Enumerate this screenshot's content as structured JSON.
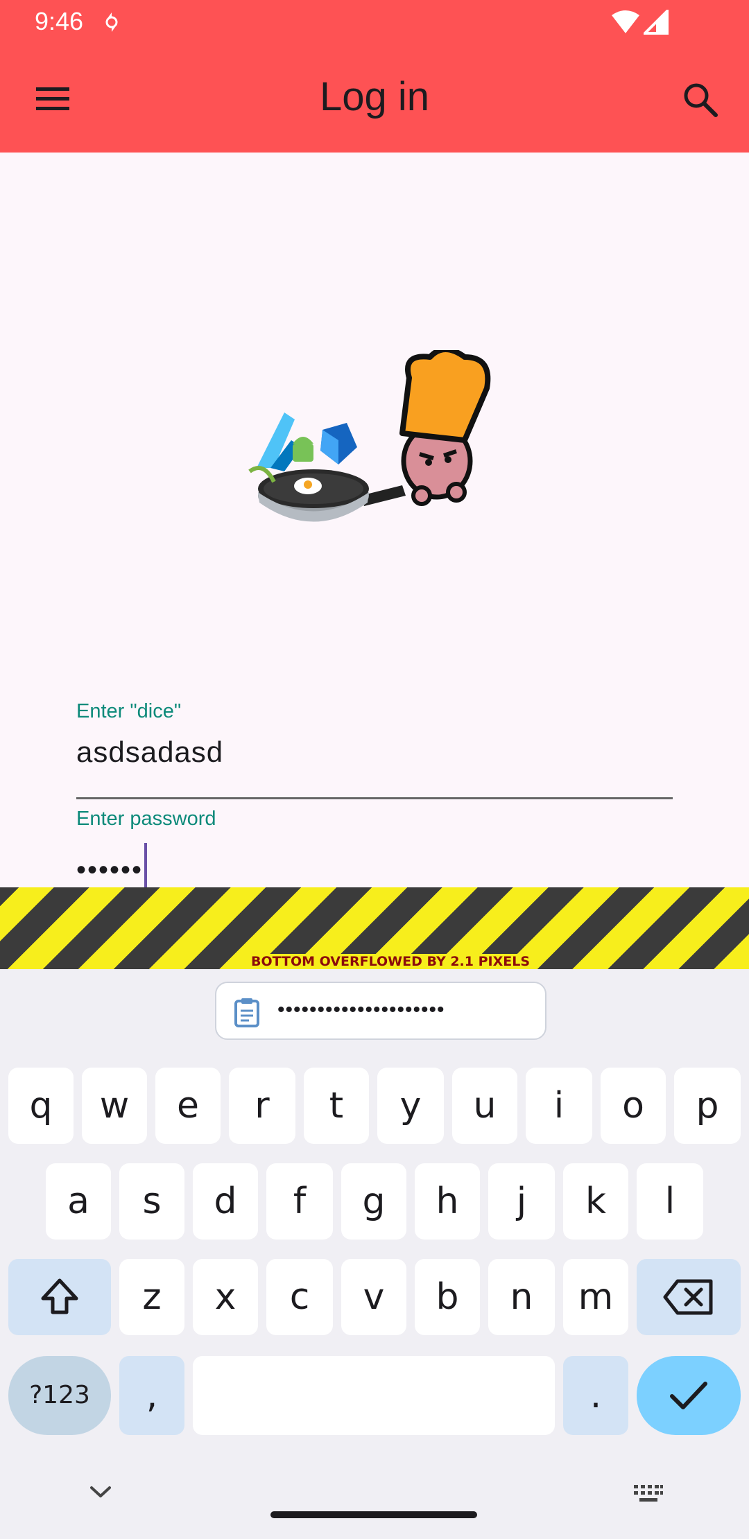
{
  "status_bar": {
    "time": "9:46"
  },
  "app_bar": {
    "title": "Log in"
  },
  "form": {
    "username_label": "Enter \"dice\"",
    "username_value": "asdsadasd",
    "password_label": "Enter password",
    "password_value": "••••••"
  },
  "overflow_message": "BOTTOM OVERFLOWED BY 2.1 PIXELS",
  "keyboard": {
    "clipboard_preview": "•••••••••••••••••••••",
    "row1": [
      "q",
      "w",
      "e",
      "r",
      "t",
      "y",
      "u",
      "i",
      "o",
      "p"
    ],
    "row2": [
      "a",
      "s",
      "d",
      "f",
      "g",
      "h",
      "j",
      "k",
      "l"
    ],
    "row3": [
      "z",
      "x",
      "c",
      "v",
      "b",
      "n",
      "m"
    ],
    "symbols_label": "?123",
    "comma_label": ",",
    "period_label": "."
  },
  "colors": {
    "app_bar": "#fe5254",
    "label_accent": "#0d8a7a",
    "caret": "#6a50a7",
    "enter_key": "#7cd0ff"
  }
}
